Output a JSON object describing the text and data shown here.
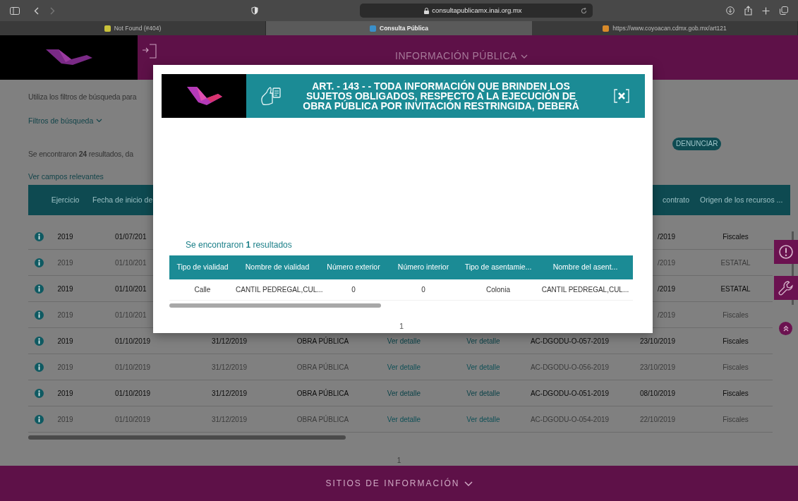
{
  "browser": {
    "address": "consultapublicamx.inai.org.mx",
    "tabs": [
      {
        "title": "Not Found (#404)",
        "selected": false
      },
      {
        "title": "Consulta Pública",
        "selected": true
      },
      {
        "title": "https://www.coyoacan.cdmx.gob.mx/art121",
        "selected": false
      }
    ]
  },
  "header": {
    "title": "INFORMACIÓN PÚBLICA"
  },
  "intro_text": "Utiliza los filtros de búsqueda para",
  "filters_link": "Filtros de búsqueda",
  "results_text": "Se encontraron **24** resultados, da",
  "report_button": "DENUNCIAR",
  "relevant_fields_link": "Ver campos relevantes",
  "table": {
    "columns": [
      "Ejercicio",
      "Fecha de inicio de",
      null,
      null,
      null,
      null,
      null,
      "contrato",
      "Origen de los recursos ..."
    ],
    "rows": [
      {
        "muted": false,
        "cells": [
          "2019",
          "01/07/201",
          null,
          null,
          null,
          null,
          null,
          "/2019",
          "Fiscales"
        ]
      },
      {
        "muted": true,
        "cells": [
          "2019",
          "01/10/201",
          null,
          null,
          null,
          null,
          null,
          "/2019",
          "ESTATAL"
        ]
      },
      {
        "muted": false,
        "cells": [
          "2019",
          "01/10/201",
          null,
          null,
          null,
          null,
          null,
          "/2019",
          "ESTATAL"
        ]
      },
      {
        "muted": true,
        "cells": [
          "2019",
          "01/10/201",
          null,
          null,
          null,
          null,
          null,
          "/2019",
          "Fiscales"
        ]
      },
      {
        "muted": false,
        "cells": [
          "2019",
          "01/10/2019",
          "31/12/2019",
          "OBRA PÚBLICA",
          "Ver detalle",
          "Ver detalle",
          "AC-DGODU-O-057-2019",
          "23/10/2019",
          "Fiscales"
        ]
      },
      {
        "muted": true,
        "cells": [
          "2019",
          "01/10/2019",
          "31/12/2019",
          "OBRA PÚBLICA",
          "Ver detalle",
          "Ver detalle",
          "AC-DGODU-O-056-2019",
          "23/10/2019",
          "Fiscales"
        ]
      },
      {
        "muted": false,
        "cells": [
          "2019",
          "01/10/2019",
          "31/12/2019",
          "OBRA PÚBLICA",
          "Ver detalle",
          "Ver detalle",
          "AC-DGODU-O-051-2019",
          "08/10/2019",
          "Fiscales"
        ]
      },
      {
        "muted": true,
        "cells": [
          "2019",
          "01/10/2019",
          "31/12/2019",
          "OBRA PÚBLICA",
          "Ver detalle",
          "Ver detalle",
          "AC-DGODU-O-054-2019",
          "22/10/2019",
          "Fiscales"
        ]
      }
    ]
  },
  "pagination": "1",
  "modal": {
    "title": "ART. - 143 - - TODA INFORMACIÓN QUE BRINDEN LOS SUJETOS OBLIGADOS, RESPECTO A LA EJECUCIÓN DE OBRA PÚBLICA POR INVITACIÓN RESTRINGIDA, DEBERÁ",
    "results_text": "Se encontraron **1** resultados",
    "table": {
      "columns": [
        "Tipo de vialidad",
        "Nombre de vialidad",
        "Número exterior",
        "Número interior",
        "Tipo de asentamie...",
        "Nombre del asent..."
      ],
      "rows": [
        [
          "Calle",
          "CANTIL PEDREGAL,CUL...",
          "0",
          "0",
          "Colonia",
          "CANTIL PEDREGAL,CUL..."
        ]
      ]
    },
    "pagination": "1"
  },
  "footer": {
    "title": "SITIOS DE INFORMACIÓN"
  }
}
